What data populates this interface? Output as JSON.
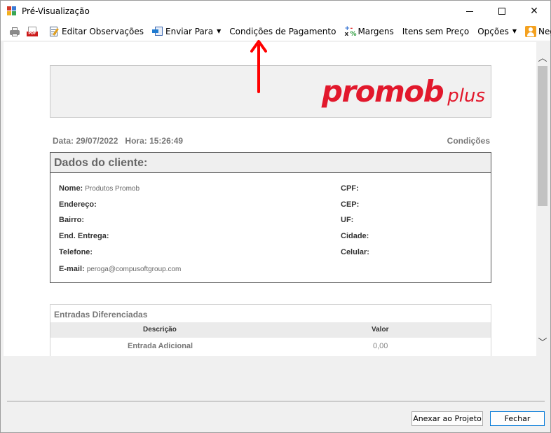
{
  "window": {
    "title": "Pré-Visualização"
  },
  "toolbar": {
    "edit_notes": "Editar Observações",
    "send_to": "Enviar Para",
    "payment_conditions": "Condições de Pagamento",
    "margins": "Margens",
    "items_no_price": "Itens sem Preço",
    "options": "Opções",
    "negotiate": "Negociar",
    "pdf_badge": "PDF"
  },
  "document": {
    "logo": {
      "main": "promob",
      "plus": "plus"
    },
    "meta_left": "Data: 29/07/2022   Hora: 15:26:49",
    "meta_right": "Condições",
    "client": {
      "title": "Dados do cliente:",
      "name_label": "Nome:",
      "name_value": "Produtos Promob",
      "address_label": "Endereço:",
      "district_label": "Bairro:",
      "delivery_label": "End. Entrega:",
      "phone_label": "Telefone:",
      "email_label": "E-mail:",
      "email_value": "peroga@compusoftgroup.com",
      "cpf_label": "CPF:",
      "cep_label": "CEP:",
      "uf_label": "UF:",
      "city_label": "Cidade:",
      "mobile_label": "Celular:"
    },
    "entries": {
      "title": "Entradas Diferenciadas",
      "col_description": "Descrição",
      "col_value": "Valor",
      "rows": [
        {
          "description": "Entrada Adicional",
          "value": "0,00"
        }
      ]
    }
  },
  "footer": {
    "attach_button": "Anexar ao Projeto",
    "close_button": "Fechar"
  },
  "colors": {
    "brand_red": "#e2182c",
    "annotation_red": "#ff0000",
    "focus_blue": "#0078d7"
  },
  "icons": [
    "printer-icon",
    "pdf-icon",
    "edit-notes-icon",
    "send-to-icon",
    "margins-icon",
    "negotiate-user-icon"
  ]
}
